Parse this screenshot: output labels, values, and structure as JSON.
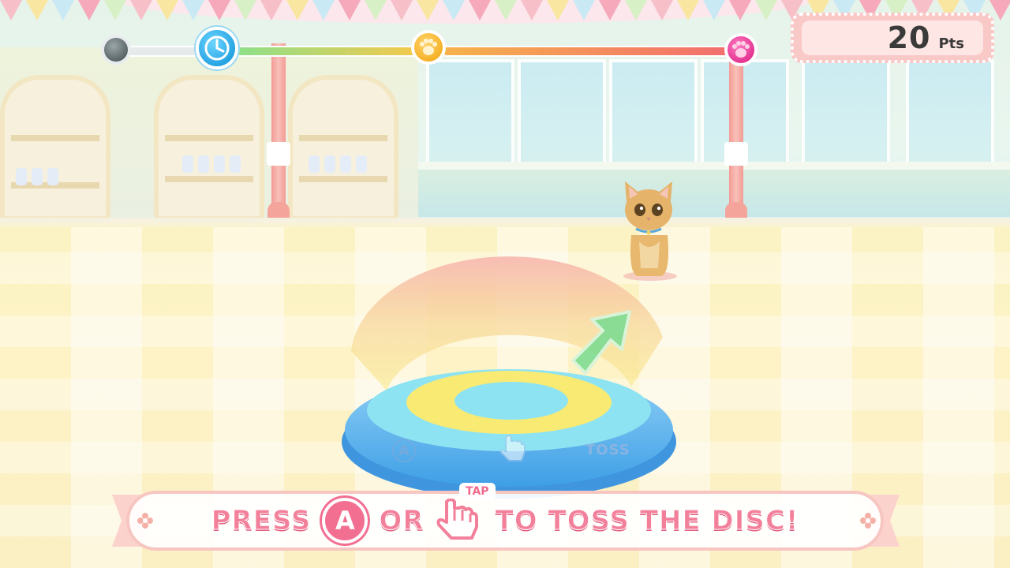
{
  "hud": {
    "points_value": "20",
    "points_unit": "Pts",
    "timeline_progress": 0.15
  },
  "instruction": {
    "press": "PRESS",
    "a_button": "A",
    "or": "OR",
    "tap_hint": "TAP",
    "rest": "TO TOSS THE DISC!"
  },
  "disc": {
    "button_label": "A",
    "action_label": "TOSS"
  },
  "colors": {
    "banner_text": "#f3809b",
    "a_button": "#f36f92",
    "points_panel": "#f9c9c8",
    "disc_blue": "#5bb8ef",
    "disc_yellow": "#f9ea73",
    "disc_cyan": "#8ee3f2",
    "arrow_green": "#7fdc92"
  },
  "icons": {
    "timeline_start": "gray-orb-icon",
    "timeline_timer": "clock-icon",
    "timeline_mid": "paw-icon",
    "timeline_end": "pink-paw-icon",
    "direction": "arrow-up-right-icon",
    "tap": "tap-hand-icon"
  }
}
